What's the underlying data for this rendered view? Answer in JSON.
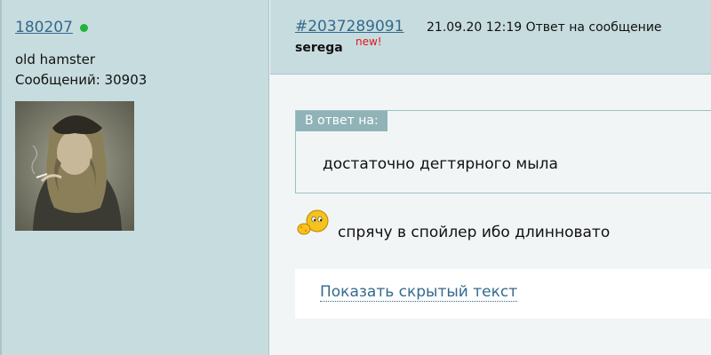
{
  "user": {
    "name": "180207",
    "title": "old hamster",
    "post_count": "Сообщений: 30903",
    "online_color": "#1fb538"
  },
  "post": {
    "id_link": "#2037289091",
    "meta": "21.09.20 12:19 Ответ на сообщение",
    "author": "serega",
    "new_badge": "new!"
  },
  "quote": {
    "header": "В ответ на:",
    "text": "достаточно дегтярного мыла"
  },
  "body": {
    "smiley_icon": "smiley-hiding-icon",
    "text": "спрячу в спойлер ибо длинновато"
  },
  "spoiler": {
    "link": "Показать скрытый текст"
  }
}
